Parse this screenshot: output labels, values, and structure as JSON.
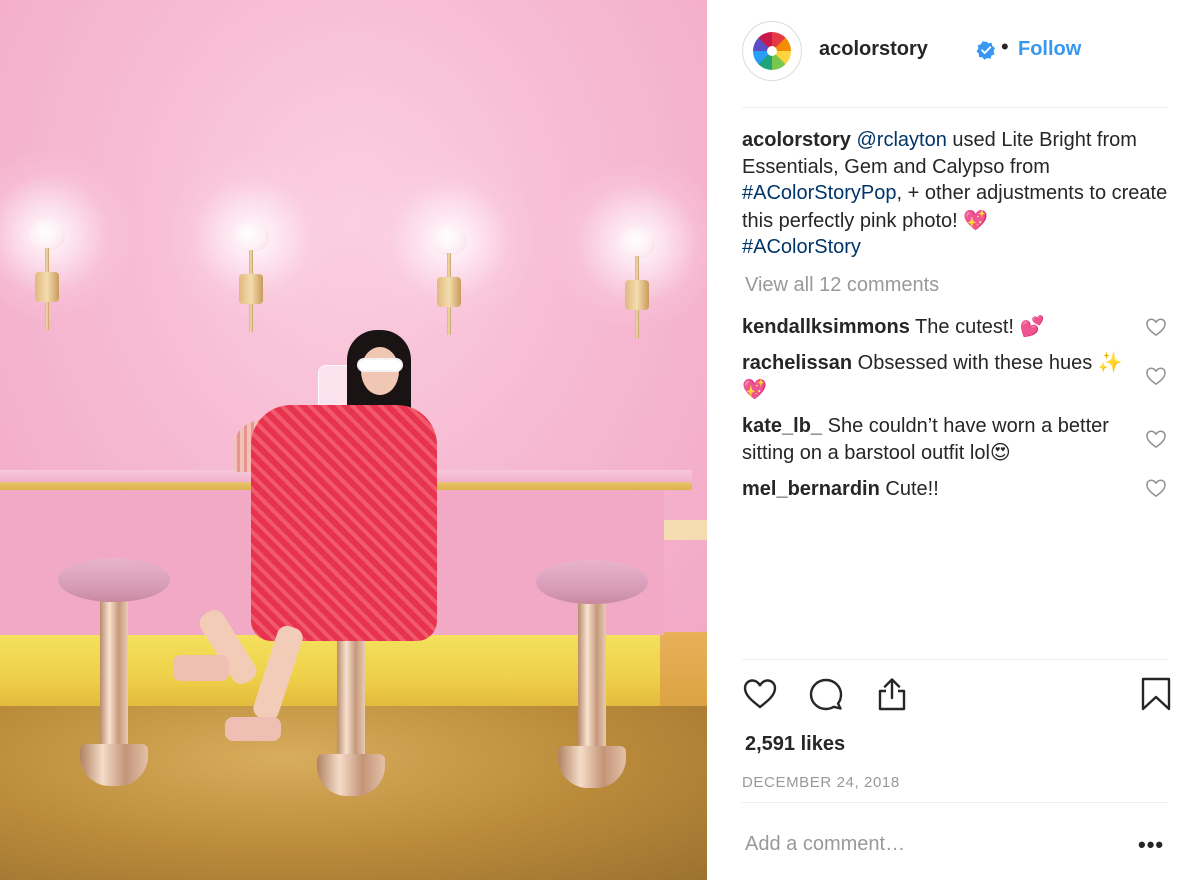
{
  "post": {
    "username": "acolorstory",
    "separator": "•",
    "follow_label": "Follow",
    "caption": {
      "username": "acolorstory",
      "mention": "@rclayton",
      "text1": " used Lite Bright from Essentials, Gem and Calypso from ",
      "hashtag1": "#AColorStoryPop",
      "text2": ", + other adjustments to create this perfectly pink photo! ",
      "emoji": "💖",
      "hashtag2": "#AColorStory"
    },
    "view_all": "View all 12 comments",
    "comments": [
      {
        "user": "kendallksimmons",
        "text": "The cutest! 💕"
      },
      {
        "user": "rachelissan",
        "text": "Obsessed with these hues ✨💖"
      },
      {
        "user": "kate_lb_",
        "text": "She couldn’t have worn a better sitting on a barstool outfit lol😍"
      },
      {
        "user": "mel_bernardin",
        "text": "Cute!!"
      }
    ],
    "likes": "2,591 likes",
    "date": "DECEMBER 24, 2018",
    "add_comment_placeholder": "Add a comment…",
    "more_label": "•••"
  },
  "icons": {
    "avatar": "color-wheel-logo",
    "verified": "verified-badge-icon",
    "like": "heart-icon",
    "comment": "comment-bubble-icon",
    "share": "share-icon",
    "save": "bookmark-icon"
  },
  "colors": {
    "link": "#003569",
    "follow": "#3897f0",
    "muted": "#999999",
    "text": "#262626"
  }
}
